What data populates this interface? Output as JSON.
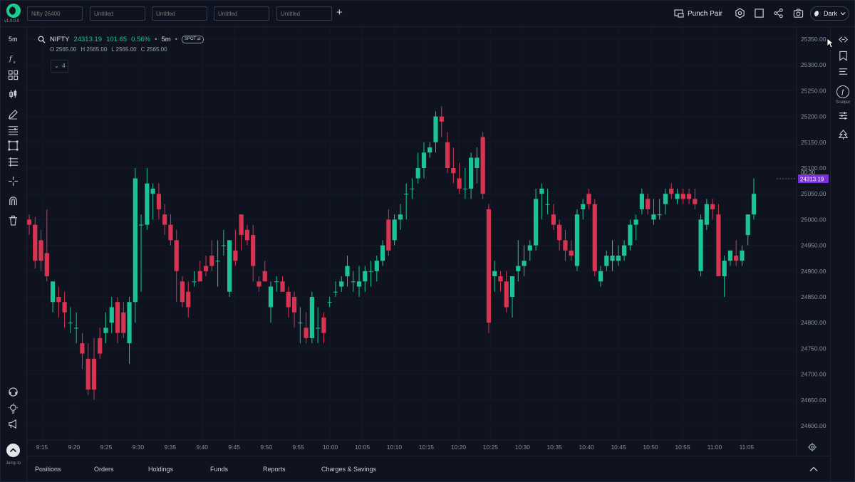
{
  "app": {
    "version": "v1.0.0.0",
    "tabs": [
      {
        "placeholder": "Nifty 26400"
      },
      {
        "placeholder": "Untitled"
      },
      {
        "placeholder": "Untitled"
      },
      {
        "placeholder": "Untitled"
      },
      {
        "placeholder": "Untitled"
      }
    ],
    "punch_pair_label": "Punch Pair",
    "theme_label": "Dark"
  },
  "left_toolbar": {
    "interval": "5m",
    "jump_label": "Jump to"
  },
  "right_toolbar": {
    "scalper_label": "Scalper"
  },
  "legend": {
    "symbol": "NIFTY",
    "price": "24313.19",
    "change": "101.65",
    "change_pct": "0.56%",
    "interval": "5m",
    "badge": "SPOT",
    "ohlc": {
      "o": "O 2565.00",
      "h": "H 2565.00",
      "l": "L 2565.00",
      "c": "C 2565.00"
    },
    "indicator_count": "4"
  },
  "price_tag": {
    "countdown": "00:30",
    "price": "24313.19"
  },
  "bottom_tabs": [
    "Positions",
    "Orders",
    "Holdings",
    "Funds",
    "Reports",
    "Charges & Savings"
  ],
  "colors": {
    "up": "#1bc397",
    "down": "#d73452",
    "tag": "#7b2fd9",
    "bg": "#0f1320"
  },
  "chart_data": {
    "type": "candlestick",
    "y_ticks": [
      "25350.00",
      "25300.00",
      "25250.00",
      "25200.00",
      "25150.00",
      "25100.00",
      "25050.00",
      "25000.00",
      "24950.00",
      "24900.00",
      "24850.00",
      "24800.00",
      "24750.00",
      "24700.00",
      "24650.00",
      "24600.00"
    ],
    "x_ticks": [
      "9:15",
      "9:20",
      "9:25",
      "9:30",
      "9:35",
      "9:40",
      "9:45",
      "9:50",
      "9:55",
      "10:00",
      "10:05",
      "10:10",
      "10:15",
      "10:20",
      "10:25",
      "10:30",
      "10:35",
      "10:40",
      "10:45",
      "10:50",
      "10:55",
      "11:00",
      "11:05"
    ],
    "ylim": [
      24590,
      25360
    ],
    "candles": [
      {
        "o": 25000,
        "h": 25010,
        "l": 24970,
        "c": 24990
      },
      {
        "o": 24990,
        "h": 25005,
        "l": 24905,
        "c": 24920
      },
      {
        "o": 24960,
        "h": 24980,
        "l": 24900,
        "c": 24920
      },
      {
        "o": 24935,
        "h": 25020,
        "l": 24880,
        "c": 24890
      },
      {
        "o": 24840,
        "h": 24880,
        "l": 24820,
        "c": 24880
      },
      {
        "o": 24850,
        "h": 24870,
        "l": 24810,
        "c": 24840
      },
      {
        "o": 24840,
        "h": 24860,
        "l": 24790,
        "c": 24820
      },
      {
        "o": 24800,
        "h": 24830,
        "l": 24780,
        "c": 24800
      },
      {
        "o": 24790,
        "h": 24820,
        "l": 24760,
        "c": 24790
      },
      {
        "o": 24760,
        "h": 24780,
        "l": 24710,
        "c": 24740
      },
      {
        "o": 24730,
        "h": 24760,
        "l": 24660,
        "c": 24670
      },
      {
        "o": 24730,
        "h": 24770,
        "l": 24650,
        "c": 24670
      },
      {
        "o": 24770,
        "h": 24790,
        "l": 24730,
        "c": 24740
      },
      {
        "o": 24780,
        "h": 24820,
        "l": 24760,
        "c": 24790
      },
      {
        "o": 24800,
        "h": 24850,
        "l": 24780,
        "c": 24830
      },
      {
        "o": 24840,
        "h": 24850,
        "l": 24760,
        "c": 24780
      },
      {
        "o": 24820,
        "h": 24840,
        "l": 24770,
        "c": 24780
      },
      {
        "o": 24760,
        "h": 24850,
        "l": 24720,
        "c": 24840
      },
      {
        "o": 24840,
        "h": 25100,
        "l": 24800,
        "c": 25080
      },
      {
        "o": 24990,
        "h": 25010,
        "l": 24860,
        "c": 24990
      },
      {
        "o": 24990,
        "h": 25100,
        "l": 24980,
        "c": 25070
      },
      {
        "o": 25050,
        "h": 25070,
        "l": 25000,
        "c": 25060
      },
      {
        "o": 25050,
        "h": 25070,
        "l": 25000,
        "c": 25020
      },
      {
        "o": 25010,
        "h": 25030,
        "l": 24970,
        "c": 24990
      },
      {
        "o": 24990,
        "h": 25010,
        "l": 24950,
        "c": 24960
      },
      {
        "o": 24960,
        "h": 24980,
        "l": 24840,
        "c": 24900
      },
      {
        "o": 24880,
        "h": 24890,
        "l": 24830,
        "c": 24840
      },
      {
        "o": 24860,
        "h": 24880,
        "l": 24810,
        "c": 24830
      },
      {
        "o": 24880,
        "h": 24900,
        "l": 24870,
        "c": 24880
      },
      {
        "o": 24900,
        "h": 24920,
        "l": 24880,
        "c": 24880
      },
      {
        "o": 24910,
        "h": 24930,
        "l": 24890,
        "c": 24900
      },
      {
        "o": 24930,
        "h": 24960,
        "l": 24900,
        "c": 24910
      },
      {
        "o": 24920,
        "h": 24960,
        "l": 24870,
        "c": 24920
      },
      {
        "o": 24950,
        "h": 24980,
        "l": 24930,
        "c": 24950
      },
      {
        "o": 24860,
        "h": 24880,
        "l": 24850,
        "c": 24960
      },
      {
        "o": 24940,
        "h": 24980,
        "l": 24910,
        "c": 24920
      },
      {
        "o": 25010,
        "h": 25010,
        "l": 24940,
        "c": 24970
      },
      {
        "o": 24980,
        "h": 24990,
        "l": 24950,
        "c": 24960
      },
      {
        "o": 24970,
        "h": 24990,
        "l": 24880,
        "c": 24910
      },
      {
        "o": 24880,
        "h": 24890,
        "l": 24860,
        "c": 24870
      },
      {
        "o": 24900,
        "h": 24920,
        "l": 24890,
        "c": 24880
      },
      {
        "o": 24830,
        "h": 24880,
        "l": 24800,
        "c": 24870
      },
      {
        "o": 24880,
        "h": 24890,
        "l": 24860,
        "c": 24880
      },
      {
        "o": 24880,
        "h": 24890,
        "l": 24860,
        "c": 24860
      },
      {
        "o": 24860,
        "h": 24870,
        "l": 24810,
        "c": 24830
      },
      {
        "o": 24850,
        "h": 24860,
        "l": 24790,
        "c": 24820
      },
      {
        "o": 24800,
        "h": 24830,
        "l": 24760,
        "c": 24800
      },
      {
        "o": 24790,
        "h": 24820,
        "l": 24760,
        "c": 24770
      },
      {
        "o": 24770,
        "h": 24860,
        "l": 24760,
        "c": 24850
      },
      {
        "o": 24790,
        "h": 24830,
        "l": 24760,
        "c": 24790
      },
      {
        "o": 24810,
        "h": 24820,
        "l": 24760,
        "c": 24780
      },
      {
        "o": 24840,
        "h": 24850,
        "l": 24830,
        "c": 24840
      },
      {
        "o": 24860,
        "h": 24880,
        "l": 24850,
        "c": 24860
      },
      {
        "o": 24870,
        "h": 24890,
        "l": 24860,
        "c": 24880
      },
      {
        "o": 24890,
        "h": 24930,
        "l": 24870,
        "c": 24910
      },
      {
        "o": 24880,
        "h": 24900,
        "l": 24860,
        "c": 24880
      },
      {
        "o": 24870,
        "h": 24910,
        "l": 24850,
        "c": 24880
      },
      {
        "o": 24880,
        "h": 24910,
        "l": 24860,
        "c": 24900
      },
      {
        "o": 24900,
        "h": 24920,
        "l": 24870,
        "c": 24900
      },
      {
        "o": 24900,
        "h": 24930,
        "l": 24880,
        "c": 24920
      },
      {
        "o": 24920,
        "h": 24960,
        "l": 24910,
        "c": 24950
      },
      {
        "o": 25000,
        "h": 25020,
        "l": 24930,
        "c": 24940
      },
      {
        "o": 24960,
        "h": 25010,
        "l": 24950,
        "c": 25000
      },
      {
        "o": 25000,
        "h": 25030,
        "l": 24980,
        "c": 25010
      },
      {
        "o": 25050,
        "h": 25070,
        "l": 25000,
        "c": 25050
      },
      {
        "o": 25060,
        "h": 25080,
        "l": 25040,
        "c": 25060
      },
      {
        "o": 25080,
        "h": 25130,
        "l": 25070,
        "c": 25100
      },
      {
        "o": 25100,
        "h": 25150,
        "l": 25080,
        "c": 25130
      },
      {
        "o": 25130,
        "h": 25150,
        "l": 25120,
        "c": 25140
      },
      {
        "o": 25150,
        "h": 25210,
        "l": 25130,
        "c": 25200
      },
      {
        "o": 25200,
        "h": 25220,
        "l": 25160,
        "c": 25190
      },
      {
        "o": 25150,
        "h": 25170,
        "l": 25090,
        "c": 25100
      },
      {
        "o": 25100,
        "h": 25140,
        "l": 25070,
        "c": 25090
      },
      {
        "o": 25080,
        "h": 25110,
        "l": 25050,
        "c": 25060
      },
      {
        "o": 25060,
        "h": 25100,
        "l": 25040,
        "c": 25060
      },
      {
        "o": 25060,
        "h": 25130,
        "l": 25040,
        "c": 25120
      },
      {
        "o": 25100,
        "h": 25140,
        "l": 25070,
        "c": 25120
      },
      {
        "o": 25160,
        "h": 25170,
        "l": 25040,
        "c": 25050
      },
      {
        "o": 25020,
        "h": 25030,
        "l": 24780,
        "c": 24800
      },
      {
        "o": 24890,
        "h": 24920,
        "l": 24860,
        "c": 24900
      },
      {
        "o": 24890,
        "h": 24900,
        "l": 24860,
        "c": 24880
      },
      {
        "o": 24880,
        "h": 24900,
        "l": 24820,
        "c": 24830
      },
      {
        "o": 24850,
        "h": 24890,
        "l": 24810,
        "c": 24890
      },
      {
        "o": 24900,
        "h": 24960,
        "l": 24880,
        "c": 24910
      },
      {
        "o": 24910,
        "h": 24950,
        "l": 24890,
        "c": 24920
      },
      {
        "o": 24940,
        "h": 24960,
        "l": 24920,
        "c": 24950
      },
      {
        "o": 24950,
        "h": 25060,
        "l": 24940,
        "c": 25040
      },
      {
        "o": 25050,
        "h": 25070,
        "l": 25000,
        "c": 25060
      },
      {
        "o": 25030,
        "h": 25060,
        "l": 25010,
        "c": 25030
      },
      {
        "o": 25010,
        "h": 25030,
        "l": 24980,
        "c": 24990
      },
      {
        "o": 24990,
        "h": 25000,
        "l": 24940,
        "c": 24960
      },
      {
        "o": 24960,
        "h": 24980,
        "l": 24920,
        "c": 24940
      },
      {
        "o": 24940,
        "h": 24960,
        "l": 24920,
        "c": 24930
      },
      {
        "o": 24910,
        "h": 25020,
        "l": 24900,
        "c": 25010
      },
      {
        "o": 25020,
        "h": 25040,
        "l": 25000,
        "c": 25030
      },
      {
        "o": 25050,
        "h": 25060,
        "l": 25020,
        "c": 25030
      },
      {
        "o": 25030,
        "h": 25040,
        "l": 24890,
        "c": 24900
      },
      {
        "o": 24880,
        "h": 24910,
        "l": 24870,
        "c": 24900
      },
      {
        "o": 24910,
        "h": 24940,
        "l": 24900,
        "c": 24930
      },
      {
        "o": 24920,
        "h": 24960,
        "l": 24900,
        "c": 24930
      },
      {
        "o": 24920,
        "h": 24950,
        "l": 24910,
        "c": 24930
      },
      {
        "o": 24930,
        "h": 24960,
        "l": 24920,
        "c": 24950
      },
      {
        "o": 24950,
        "h": 25000,
        "l": 24940,
        "c": 24990
      },
      {
        "o": 24990,
        "h": 25010,
        "l": 24960,
        "c": 25000
      },
      {
        "o": 25020,
        "h": 25060,
        "l": 25010,
        "c": 25050
      },
      {
        "o": 25040,
        "h": 25050,
        "l": 25010,
        "c": 25020
      },
      {
        "o": 25000,
        "h": 25040,
        "l": 24990,
        "c": 25010
      },
      {
        "o": 25010,
        "h": 25040,
        "l": 25000,
        "c": 25010
      },
      {
        "o": 25030,
        "h": 25060,
        "l": 25010,
        "c": 25050
      },
      {
        "o": 25060,
        "h": 25070,
        "l": 25040,
        "c": 25050
      },
      {
        "o": 25040,
        "h": 25060,
        "l": 25030,
        "c": 25050
      },
      {
        "o": 25050,
        "h": 25060,
        "l": 25030,
        "c": 25040
      },
      {
        "o": 25050,
        "h": 25060,
        "l": 25030,
        "c": 25040
      },
      {
        "o": 25040,
        "h": 25060,
        "l": 25020,
        "c": 25030
      },
      {
        "o": 24900,
        "h": 25010,
        "l": 24890,
        "c": 25000
      },
      {
        "o": 24990,
        "h": 25040,
        "l": 24980,
        "c": 25030
      },
      {
        "o": 25030,
        "h": 25040,
        "l": 25000,
        "c": 25020
      },
      {
        "o": 25010,
        "h": 25030,
        "l": 24890,
        "c": 24890
      },
      {
        "o": 24890,
        "h": 24930,
        "l": 24850,
        "c": 24920
      },
      {
        "o": 24920,
        "h": 24940,
        "l": 24910,
        "c": 24940
      },
      {
        "o": 24930,
        "h": 24960,
        "l": 24910,
        "c": 24920
      },
      {
        "o": 24920,
        "h": 24950,
        "l": 24910,
        "c": 24940
      },
      {
        "o": 24970,
        "h": 25010,
        "l": 24950,
        "c": 25010
      },
      {
        "o": 25010,
        "h": 25080,
        "l": 25000,
        "c": 25050
      }
    ]
  }
}
